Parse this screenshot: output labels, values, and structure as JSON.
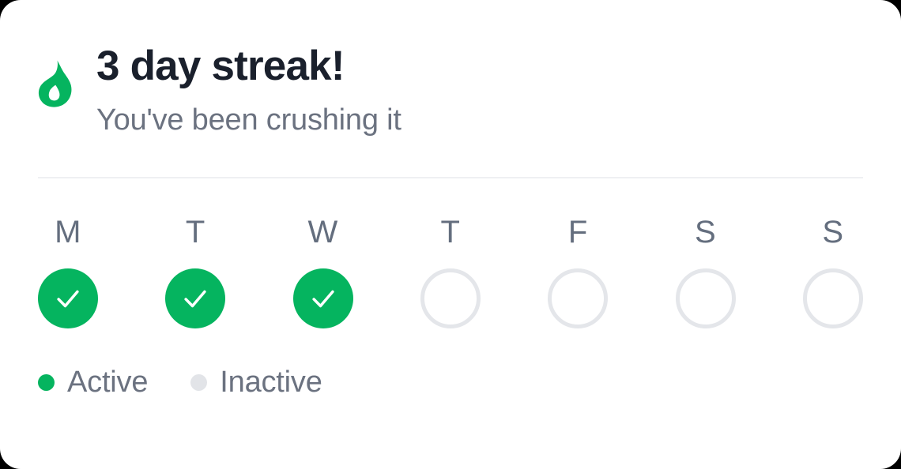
{
  "card": {
    "background_color": "#FFFFFF",
    "corner_radius_px": 26
  },
  "header": {
    "icon": "flame-icon",
    "icon_color": "#05B45F",
    "title": "3 day streak!",
    "title_color": "#1A202C",
    "subtitle": "You've been crushing it",
    "subtitle_color": "#6B7280"
  },
  "divider": {
    "color": "#EFF0F2"
  },
  "week": {
    "days": [
      {
        "label": "M",
        "state": "active",
        "icon": "check-icon"
      },
      {
        "label": "T",
        "state": "active",
        "icon": "check-icon"
      },
      {
        "label": "W",
        "state": "active",
        "icon": "check-icon"
      },
      {
        "label": "T",
        "state": "inactive",
        "icon": ""
      },
      {
        "label": "F",
        "state": "inactive",
        "icon": ""
      },
      {
        "label": "S",
        "state": "inactive",
        "icon": ""
      },
      {
        "label": "S",
        "state": "inactive",
        "icon": ""
      }
    ],
    "active_color": "#05B45F",
    "inactive_border_color": "#E4E6EA",
    "label_color": "#646E7E"
  },
  "legend": {
    "items": [
      {
        "label": "Active",
        "color": "#05B45F"
      },
      {
        "label": "Inactive",
        "color": "#E2E4E8"
      }
    ],
    "label_color": "#6B7280"
  }
}
